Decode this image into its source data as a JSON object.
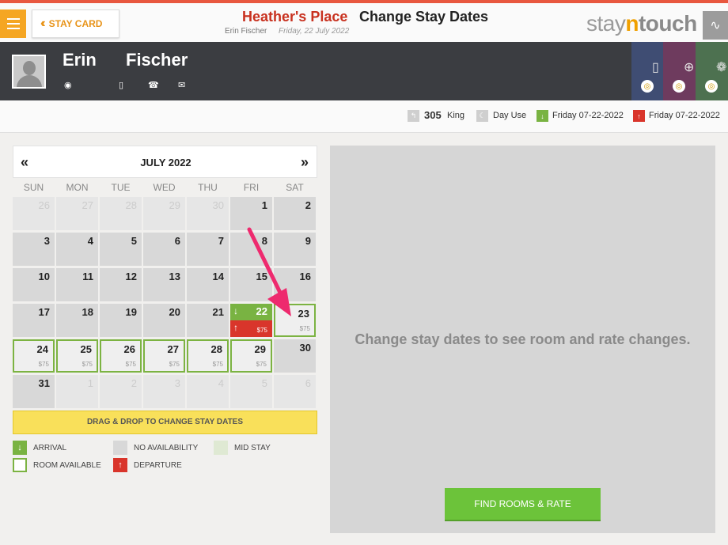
{
  "header": {
    "stay_card_label": "STAY CARD",
    "hotel_name": "Heather's Place",
    "page_title": "Change Stay Dates",
    "guest_name": "Erin Fischer",
    "date": "Friday, 22 July 2022",
    "logo_parts": [
      "stay",
      "n",
      "touch"
    ]
  },
  "guest": {
    "first_name": "Erin",
    "last_name": "Fischer",
    "icons": [
      "location-icon",
      "mobile-icon",
      "phone-icon",
      "email-icon"
    ]
  },
  "info_bar": {
    "room_number": "305",
    "room_type": "King",
    "rate_label": "Day Use",
    "arrival_date": "Friday 07-22-2022",
    "departure_date": "Friday 07-22-2022"
  },
  "calendar": {
    "month_label": "JULY 2022",
    "weekdays": [
      "SUN",
      "MON",
      "TUE",
      "WED",
      "THU",
      "FRI",
      "SAT"
    ],
    "weeks": [
      [
        {
          "d": "26",
          "s": "out"
        },
        {
          "d": "27",
          "s": "out"
        },
        {
          "d": "28",
          "s": "out"
        },
        {
          "d": "29",
          "s": "out"
        },
        {
          "d": "30",
          "s": "out"
        },
        {
          "d": "1",
          "s": "grey"
        },
        {
          "d": "2",
          "s": "grey"
        }
      ],
      [
        {
          "d": "3",
          "s": "grey"
        },
        {
          "d": "4",
          "s": "grey"
        },
        {
          "d": "5",
          "s": "grey"
        },
        {
          "d": "6",
          "s": "grey"
        },
        {
          "d": "7",
          "s": "grey"
        },
        {
          "d": "8",
          "s": "grey"
        },
        {
          "d": "9",
          "s": "grey"
        }
      ],
      [
        {
          "d": "10",
          "s": "grey"
        },
        {
          "d": "11",
          "s": "grey"
        },
        {
          "d": "12",
          "s": "grey"
        },
        {
          "d": "13",
          "s": "grey"
        },
        {
          "d": "14",
          "s": "grey"
        },
        {
          "d": "15",
          "s": "grey"
        },
        {
          "d": "16",
          "s": "grey"
        }
      ],
      [
        {
          "d": "17",
          "s": "grey"
        },
        {
          "d": "18",
          "s": "grey"
        },
        {
          "d": "19",
          "s": "grey"
        },
        {
          "d": "20",
          "s": "grey"
        },
        {
          "d": "21",
          "s": "grey"
        },
        {
          "d": "22",
          "s": "arrive",
          "p": "$75"
        },
        {
          "d": "23",
          "s": "avail",
          "p": "$75"
        }
      ],
      [
        {
          "d": "24",
          "s": "avail",
          "p": "$75"
        },
        {
          "d": "25",
          "s": "avail",
          "p": "$75"
        },
        {
          "d": "26",
          "s": "avail",
          "p": "$75"
        },
        {
          "d": "27",
          "s": "avail",
          "p": "$75"
        },
        {
          "d": "28",
          "s": "avail",
          "p": "$75"
        },
        {
          "d": "29",
          "s": "avail",
          "p": "$75"
        },
        {
          "d": "30",
          "s": "grey"
        }
      ],
      [
        {
          "d": "31",
          "s": "grey"
        },
        {
          "d": "1",
          "s": "out"
        },
        {
          "d": "2",
          "s": "out"
        },
        {
          "d": "3",
          "s": "out"
        },
        {
          "d": "4",
          "s": "out"
        },
        {
          "d": "5",
          "s": "out"
        },
        {
          "d": "6",
          "s": "out"
        }
      ]
    ]
  },
  "drag_hint": "DRAG & DROP TO CHANGE STAY DATES",
  "legend": {
    "arrival": "ARRIVAL",
    "no_availability": "NO AVAILABILITY",
    "mid_stay": "MID STAY",
    "room_available": "ROOM AVAILABLE",
    "departure": "DEPARTURE"
  },
  "right_panel": {
    "message": "Change stay dates to see room and rate changes.",
    "find_button": "FIND ROOMS & RATE"
  },
  "colors": {
    "accent_orange": "#f5a623",
    "hotel_red": "#c8311f",
    "arrival_green": "#79b342",
    "departure_red": "#d9352b",
    "find_green": "#6cc33a",
    "annotation_pink": "#ee2a6e"
  }
}
